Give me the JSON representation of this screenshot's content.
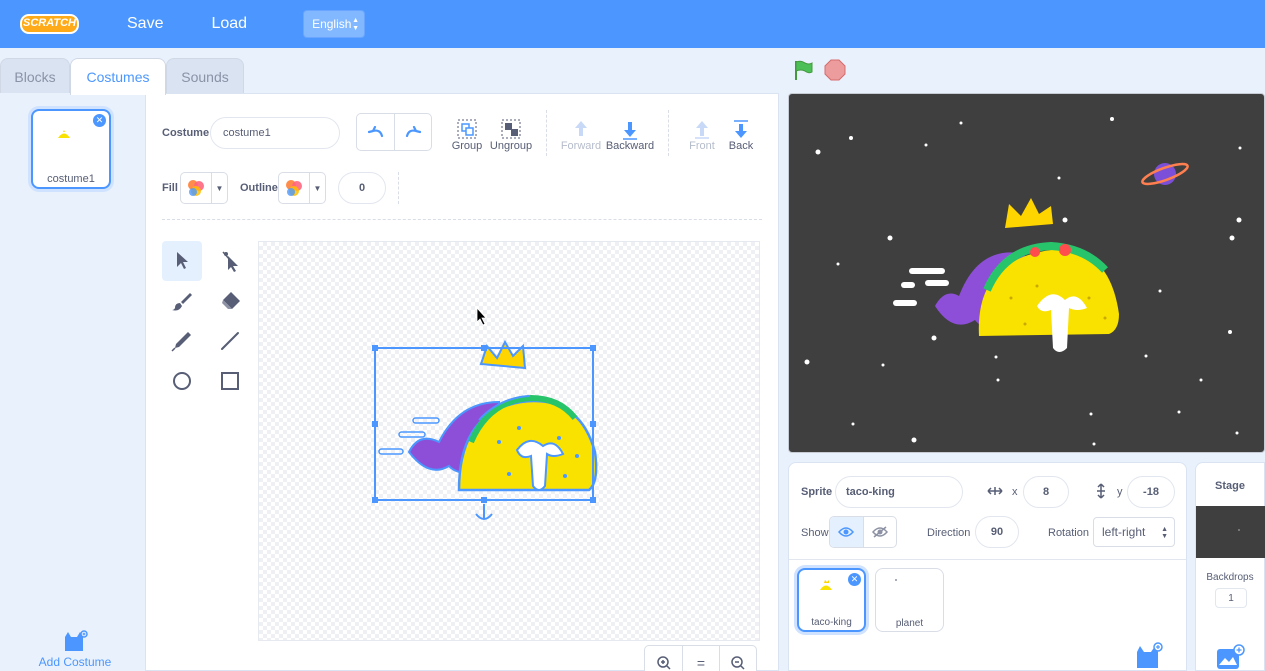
{
  "menubar": {
    "logo_text": "SCRATCH",
    "save_label": "Save",
    "load_label": "Load",
    "language": "English"
  },
  "tabs": {
    "blocks": "Blocks",
    "costumes": "Costumes",
    "sounds": "Sounds"
  },
  "costume_list": {
    "items": [
      {
        "name": "costume1"
      }
    ],
    "add_label": "Add Costume"
  },
  "editor": {
    "costume_label": "Costume",
    "costume_name": "costume1",
    "group_label": "Group",
    "ungroup_label": "Ungroup",
    "forward_label": "Forward",
    "backward_label": "Backward",
    "front_label": "Front",
    "back_label": "Back",
    "fill_label": "Fill",
    "outline_label": "Outline",
    "outline_width": "0",
    "zoom_reset": "="
  },
  "colors": {
    "accent": "#4c97ff",
    "stage_bg": "#3f3f3f",
    "taco_yellow": "#f9e100",
    "crown_yellow": "#ffd500",
    "purple": "#8e4fd8"
  },
  "sprite_info": {
    "sprite_label": "Sprite",
    "sprite_name": "taco-king",
    "x_label": "x",
    "x_value": "8",
    "y_label": "y",
    "y_value": "-18",
    "show_label": "Show",
    "direction_label": "Direction",
    "direction_value": "90",
    "rotation_label": "Rotation",
    "rotation_value": "left-right"
  },
  "sprites": [
    {
      "name": "taco-king"
    },
    {
      "name": "planet"
    }
  ],
  "stage_panel": {
    "title": "Stage",
    "backdrops_label": "Backdrops",
    "backdrops_count": "1"
  }
}
